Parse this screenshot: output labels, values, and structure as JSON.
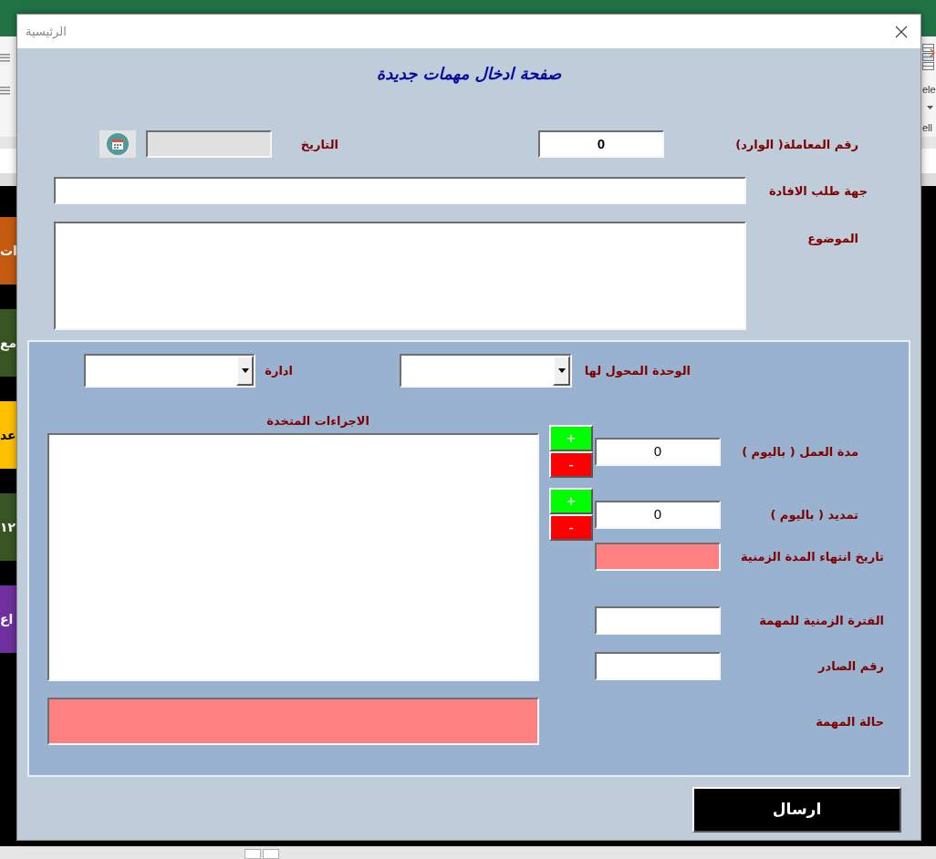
{
  "excel": {
    "ribbon_labels": [
      "ele",
      "ell"
    ],
    "sheet_buttons": [
      {
        "text": "ات",
        "color": "#c55a11"
      },
      {
        "text": "مع",
        "color": "#375623"
      },
      {
        "text": "عد",
        "color": "#ffc000"
      },
      {
        "text": "١٢",
        "color": "#375623"
      },
      {
        "text": "اع",
        "color": "#7030a0"
      }
    ]
  },
  "dialog": {
    "title": "الرئيسية",
    "heading": "صفحة ادخال مهمات جديدة",
    "transaction_number": {
      "label": "رقم المعاملة( الوارد)",
      "value": "0"
    },
    "date": {
      "label": "التاريخ",
      "disabled": true
    },
    "requesting_party": {
      "label": "جهة طلب الافادة"
    },
    "subject": {
      "label": "الموضوع"
    },
    "assignment": {
      "unit": {
        "label": "الوحدة المحول لها"
      },
      "department": {
        "label": "ادارة"
      },
      "actions_taken": {
        "label": "الاجراءات المتخدة"
      },
      "rows": [
        {
          "kind": "stepper",
          "label": "مدة العمل ( باليوم )",
          "value": "0",
          "buttons": [
            {
              "text": "+",
              "color": "#00ff00"
            },
            {
              "text": "-",
              "color": "#ff0000"
            }
          ]
        },
        {
          "kind": "stepper",
          "label": "تمديد ( باليوم )",
          "value": "0",
          "buttons": [
            {
              "text": "+",
              "color": "#00ff00"
            },
            {
              "text": "-",
              "color": "#ff0000"
            }
          ]
        },
        {
          "kind": "highlight",
          "label": "تاريخ انتهاء المدة الزمنية"
        },
        {
          "kind": "text",
          "label": "الفترة الزمنية للمهمة"
        },
        {
          "kind": "text",
          "label": "رقم الصادر"
        }
      ],
      "task_status": {
        "label": "حالة المهمة"
      }
    },
    "send_button": "ارسال"
  }
}
